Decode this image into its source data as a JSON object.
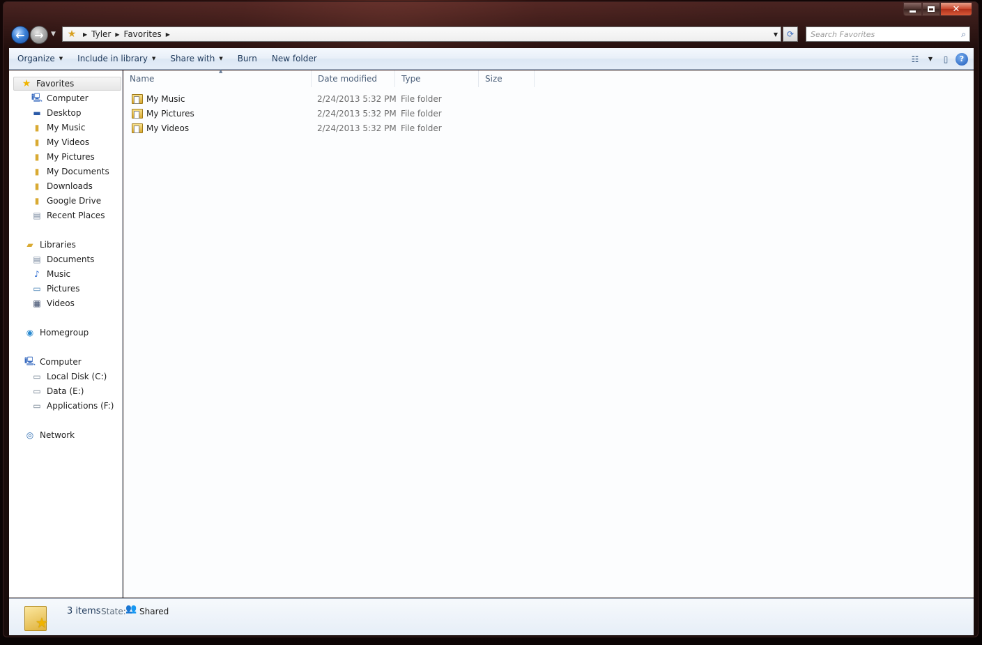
{
  "window": {
    "caption": {
      "minimize": "",
      "maximize": "",
      "close": "✕"
    }
  },
  "address": {
    "breadcrumbs": [
      "Tyler",
      "Favorites"
    ],
    "search_placeholder": "Search Favorites"
  },
  "toolbar": {
    "organize": "Organize",
    "include_in_library": "Include in library",
    "share_with": "Share with",
    "burn": "Burn",
    "new_folder": "New folder"
  },
  "navpane": {
    "favorites": {
      "label": "Favorites",
      "items": [
        "Computer",
        "Desktop",
        "My Music",
        "My Videos",
        "My Pictures",
        "My Documents",
        "Downloads",
        "Google Drive",
        "Recent Places"
      ]
    },
    "libraries": {
      "label": "Libraries",
      "items": [
        "Documents",
        "Music",
        "Pictures",
        "Videos"
      ]
    },
    "homegroup": {
      "label": "Homegroup"
    },
    "computer": {
      "label": "Computer",
      "items": [
        "Local Disk (C:)",
        "Data (E:)",
        "Applications (F:)"
      ]
    },
    "network": {
      "label": "Network"
    }
  },
  "columns": {
    "name": "Name",
    "date_modified": "Date modified",
    "type": "Type",
    "size": "Size"
  },
  "files": [
    {
      "name": "My Music",
      "date": "2/24/2013 5:32 PM",
      "type": "File folder"
    },
    {
      "name": "My Pictures",
      "date": "2/24/2013 5:32 PM",
      "type": "File folder"
    },
    {
      "name": "My Videos",
      "date": "2/24/2013 5:32 PM",
      "type": "File folder"
    }
  ],
  "details": {
    "count": "3 items",
    "state_label": "State:",
    "state_value": "Shared"
  },
  "icons": {
    "favorites": "star-icon",
    "folder": "folder-icon",
    "computer": "computer-icon",
    "homegroup": "homegroup-icon",
    "network": "network-icon"
  }
}
